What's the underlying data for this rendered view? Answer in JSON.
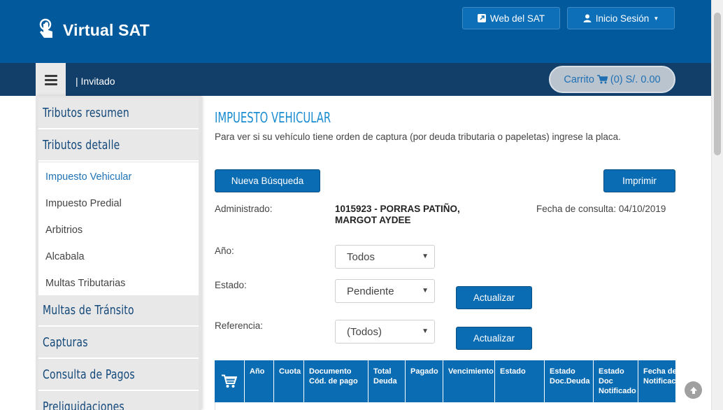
{
  "header": {
    "app_title": "Virtual SAT",
    "web_sat_label": "Web del SAT",
    "login_label": "Inicio Sesión",
    "brand_color": "#025a9c"
  },
  "navbar": {
    "user_label": "| Invitado",
    "cart_label": "Carrito",
    "cart_summary": "(0) S/. 0.00"
  },
  "sidebar": {
    "sections": [
      {
        "label": "Tributos resumen"
      },
      {
        "label": "Tributos detalle"
      },
      {
        "label": "Multas de Tránsito"
      },
      {
        "label": "Capturas"
      },
      {
        "label": "Consulta de Pagos"
      },
      {
        "label": "Preliquidaciones"
      }
    ],
    "sub_items": [
      {
        "label": "Impuesto Vehicular",
        "active": true
      },
      {
        "label": "Impuesto Predial"
      },
      {
        "label": "Arbitrios"
      },
      {
        "label": "Alcabala"
      },
      {
        "label": "Multas Tributarias"
      }
    ]
  },
  "main": {
    "title": "IMPUESTO VEHICULAR",
    "description": "Para ver si su vehículo tiene orden de captura (por deuda tributaria o papeletas) ingrese la placa.",
    "new_search_label": "Nueva Búsqueda",
    "print_label": "Imprimir",
    "administered_label": "Administrado:",
    "administered_value": "1015923 - PORRAS PATIÑO, MARGOT AYDEE",
    "consult_date": "Fecha de consulta: 04/10/2019",
    "year_label": "Año:",
    "year_value": "Todos",
    "status_label": "Estado:",
    "status_value": "Pendiente",
    "reference_label": "Referencia:",
    "reference_value": "(Todos)",
    "update_label": "Actualizar"
  },
  "table": {
    "headers": [
      "Año",
      "Cuota",
      "Documento\nCód. de pago",
      "Total\nDeuda",
      "Pagado",
      "Vencimiento",
      "Estado",
      "Estado\nDoc.Deuda",
      "Estado\nDoc\nNotificado",
      "Fecha de\nNotificación"
    ]
  }
}
